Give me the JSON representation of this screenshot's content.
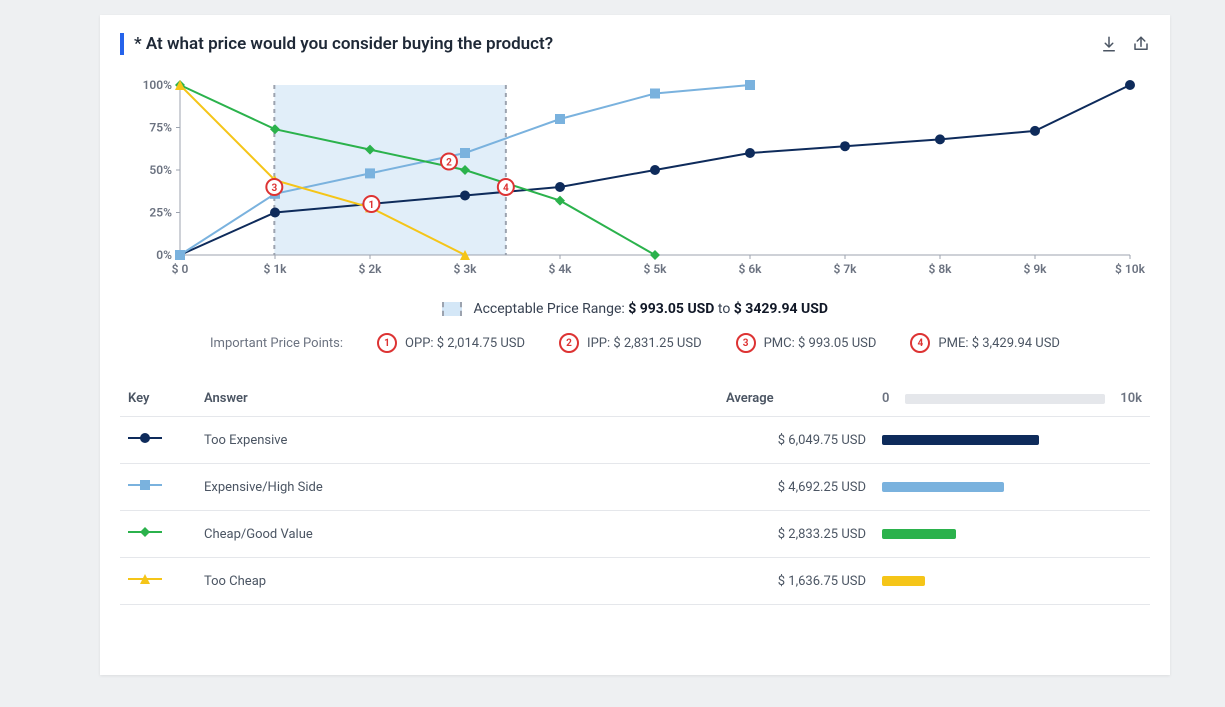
{
  "title": "* At what price would you consider buying the product?",
  "chart_data": {
    "type": "line",
    "title": "* At what price would you consider buying the product?",
    "xlabel": "",
    "ylabel": "",
    "x": [
      0,
      1000,
      2000,
      3000,
      4000,
      5000,
      6000,
      7000,
      8000,
      9000,
      10000
    ],
    "x_ticks": [
      "$ 0",
      "$ 1k",
      "$ 2k",
      "$ 3k",
      "$ 4k",
      "$ 5k",
      "$ 6k",
      "$ 7k",
      "$ 8k",
      "$ 9k",
      "$ 10k"
    ],
    "y_ticks": [
      "0%",
      "25%",
      "50%",
      "75%",
      "100%"
    ],
    "ylim": [
      0,
      100
    ],
    "xlim": [
      0,
      10000
    ],
    "series": [
      {
        "name": "Too Expensive",
        "color": "#0e2b5b",
        "marker": "circle",
        "values": [
          0,
          25,
          30,
          35,
          40,
          50,
          60,
          64,
          68,
          73,
          100
        ]
      },
      {
        "name": "Expensive/High Side",
        "color": "#7ab2de",
        "marker": "square",
        "values": [
          0,
          36,
          48,
          60,
          80,
          95,
          100,
          null,
          null,
          null,
          null
        ]
      },
      {
        "name": "Cheap/Good Value",
        "color": "#2bb24c",
        "marker": "diamond",
        "values": [
          100,
          74,
          62,
          50,
          32,
          0,
          null,
          null,
          null,
          null,
          null
        ]
      },
      {
        "name": "Too Cheap",
        "color": "#f5c518",
        "marker": "triangle",
        "values": [
          100,
          44,
          28,
          0,
          null,
          null,
          null,
          null,
          null,
          null,
          null
        ]
      }
    ],
    "acceptable_band": {
      "low_x": 993.05,
      "high_x": 3429.94
    },
    "points_of_interest": [
      {
        "n": 1,
        "label": "OPP",
        "x": 2014.75,
        "y": 30
      },
      {
        "n": 2,
        "label": "IPP",
        "x": 2831.25,
        "y": 55
      },
      {
        "n": 3,
        "label": "PMC",
        "x": 993.05,
        "y": 40
      },
      {
        "n": 4,
        "label": "PME",
        "x": 3429.94,
        "y": 40
      }
    ]
  },
  "range": {
    "label": "Acceptable Price Range: ",
    "low": "$ 993.05 USD",
    "sep": " to ",
    "high": "$ 3429.94 USD"
  },
  "price_points": {
    "label": "Important Price Points:",
    "items": [
      {
        "n": 1,
        "text": "OPP: $ 2,014.75 USD"
      },
      {
        "n": 2,
        "text": "IPP: $ 2,831.25 USD"
      },
      {
        "n": 3,
        "text": "PMC: $ 993.05 USD"
      },
      {
        "n": 4,
        "text": "PME: $ 3,429.94 USD"
      }
    ]
  },
  "table": {
    "headers": {
      "key": "Key",
      "answer": "Answer",
      "average": "Average",
      "bar_min": "0",
      "bar_max": "10k"
    },
    "bar_max_value": 10000,
    "rows": [
      {
        "answer": "Too Expensive",
        "average_text": "$ 6,049.75 USD",
        "average_value": 6049.75,
        "color": "#0e2b5b",
        "marker": "circle"
      },
      {
        "answer": "Expensive/High Side",
        "average_text": "$ 4,692.25 USD",
        "average_value": 4692.25,
        "color": "#7ab2de",
        "marker": "square"
      },
      {
        "answer": "Cheap/Good Value",
        "average_text": "$ 2,833.25 USD",
        "average_value": 2833.25,
        "color": "#2bb24c",
        "marker": "diamond"
      },
      {
        "answer": "Too Cheap",
        "average_text": "$ 1,636.75 USD",
        "average_value": 1636.75,
        "color": "#f5c518",
        "marker": "triangle"
      }
    ]
  }
}
